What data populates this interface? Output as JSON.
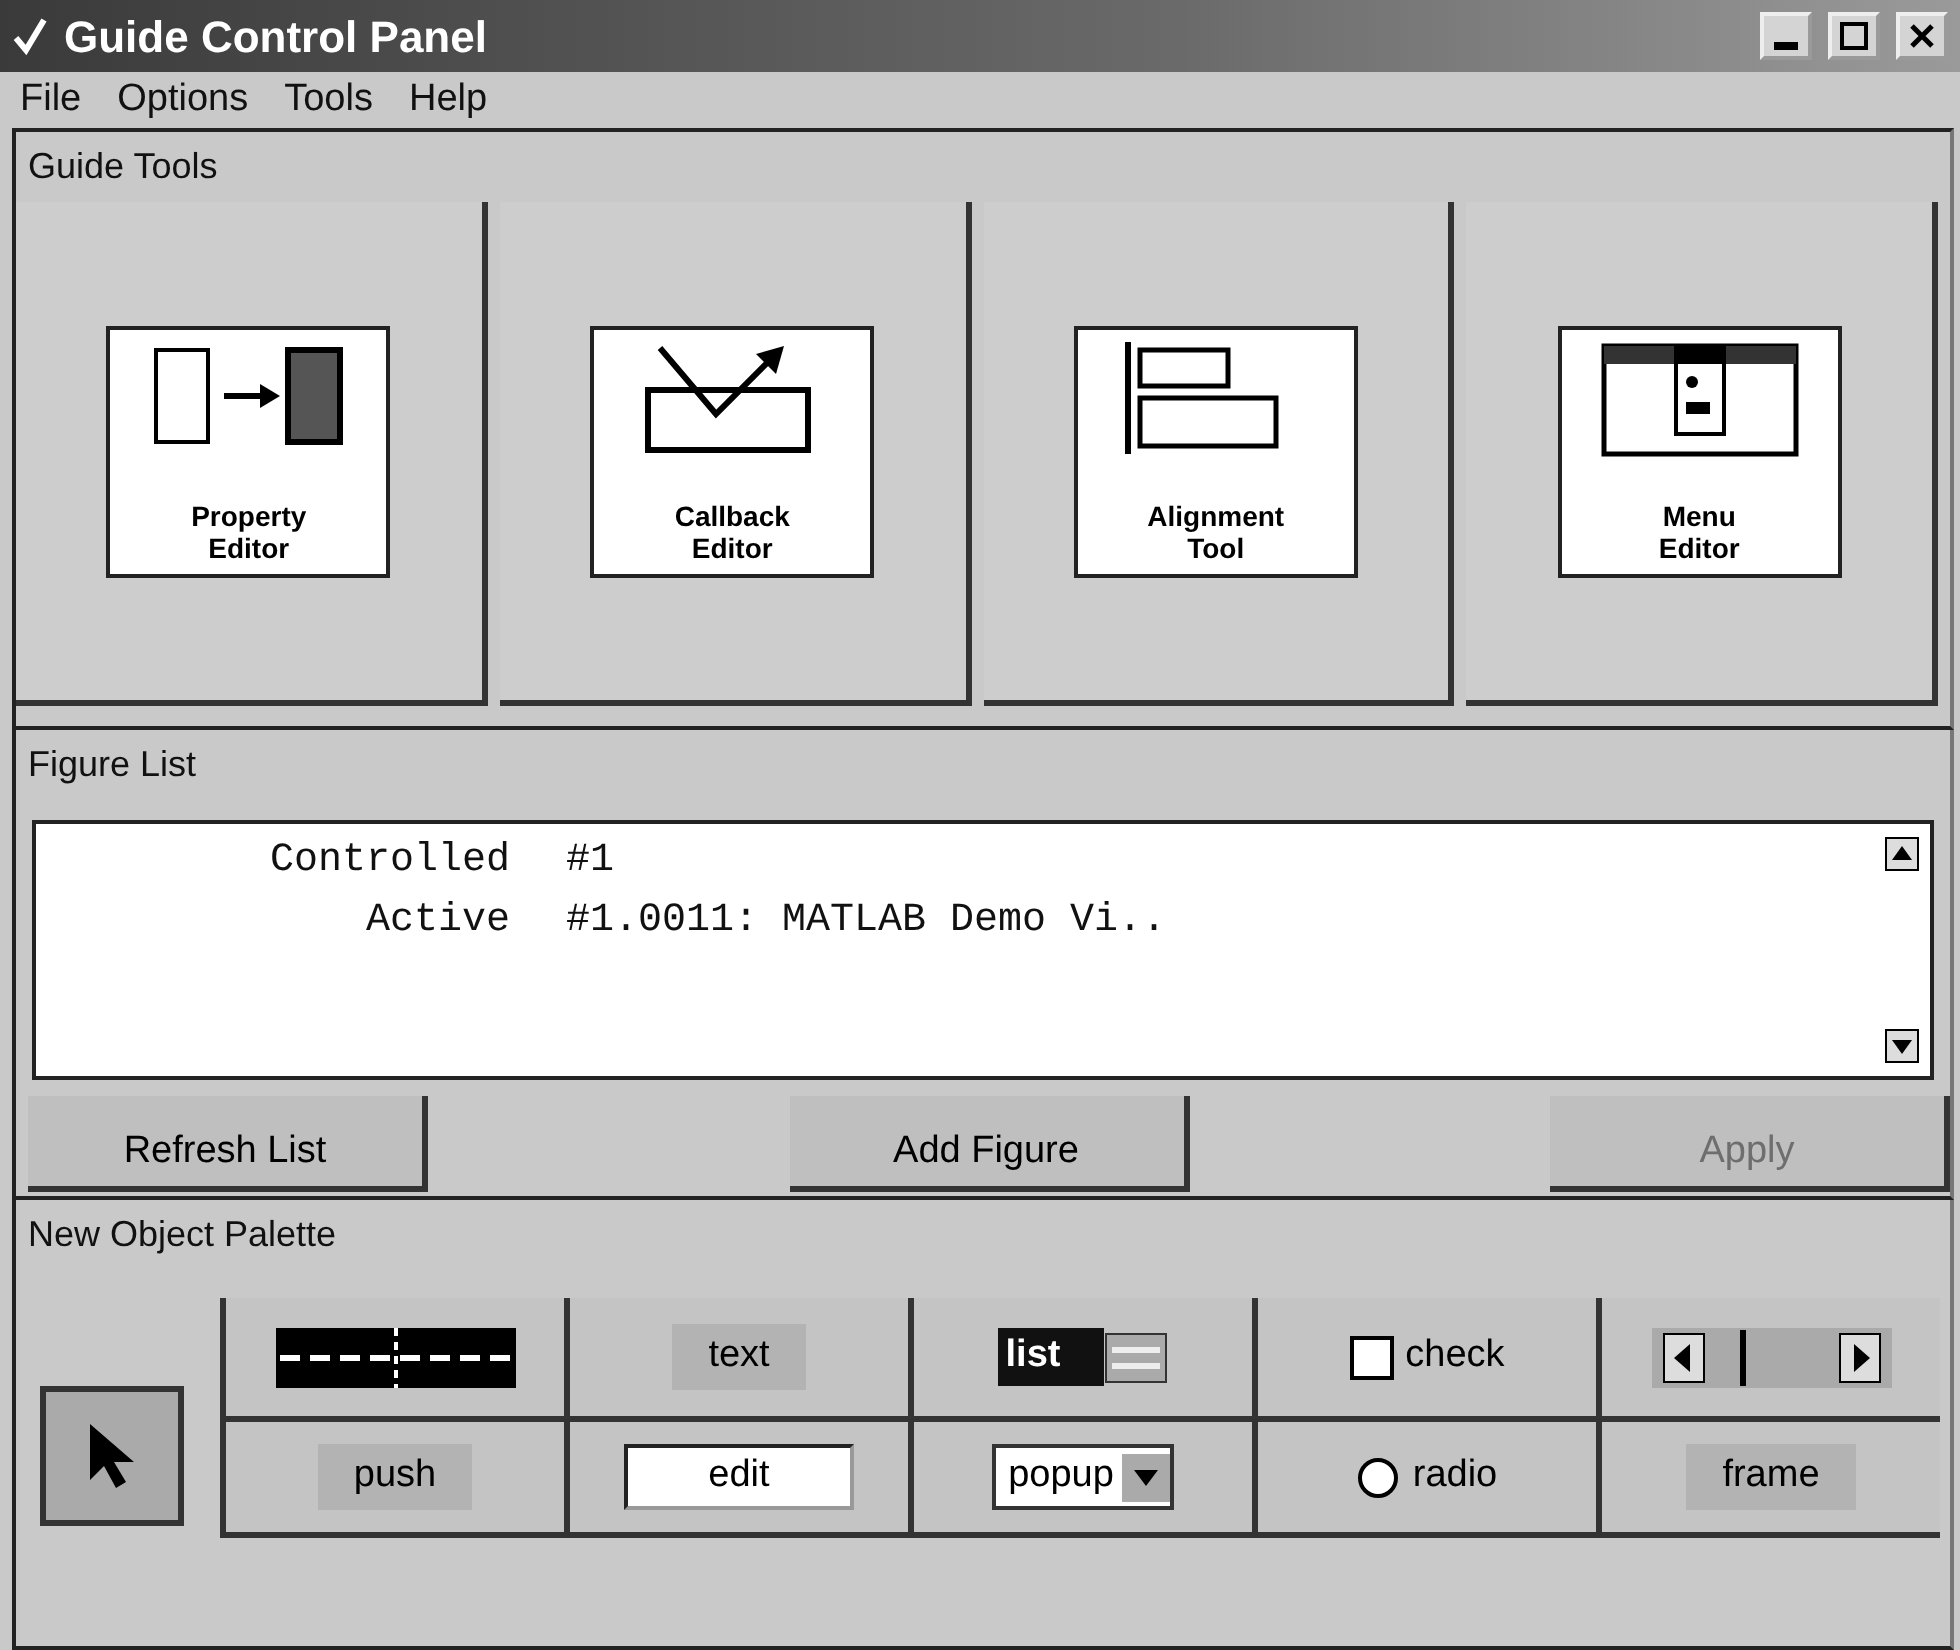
{
  "window": {
    "title": "Guide Control Panel"
  },
  "menu": [
    "File",
    "Options",
    "Tools",
    "Help"
  ],
  "guide_tools": {
    "title": "Guide Tools",
    "tools": [
      {
        "kind": "property",
        "label_lines": [
          "Property",
          "Editor"
        ]
      },
      {
        "kind": "callback",
        "label_lines": [
          "Callback",
          "Editor"
        ]
      },
      {
        "kind": "alignment",
        "label_lines": [
          "Alignment",
          "Tool"
        ]
      },
      {
        "kind": "menu",
        "label_lines": [
          "Menu",
          "Editor"
        ]
      }
    ]
  },
  "figure_list": {
    "title": "Figure List",
    "rows": [
      {
        "label": "Controlled",
        "value": "#1"
      },
      {
        "label": "Active",
        "value": "#1.0011: MATLAB Demo Vi.."
      }
    ],
    "buttons": [
      {
        "label": "Refresh List",
        "disabled": false
      },
      {
        "label": "Add Figure",
        "disabled": false
      },
      {
        "label": "Apply",
        "disabled": true
      }
    ]
  },
  "palette": {
    "title": "New Object Palette",
    "pointer": {
      "selected": true
    },
    "items": [
      {
        "kind": "axes"
      },
      {
        "kind": "text",
        "label": "text"
      },
      {
        "kind": "list",
        "label": "list"
      },
      {
        "kind": "check",
        "label": "check",
        "checked": false
      },
      {
        "kind": "slider"
      },
      {
        "kind": "push",
        "label": "push"
      },
      {
        "kind": "edit",
        "label": "edit"
      },
      {
        "kind": "popup",
        "label": "popup"
      },
      {
        "kind": "radio",
        "label": "radio",
        "checked": false
      },
      {
        "kind": "frame",
        "label": "frame"
      }
    ]
  }
}
